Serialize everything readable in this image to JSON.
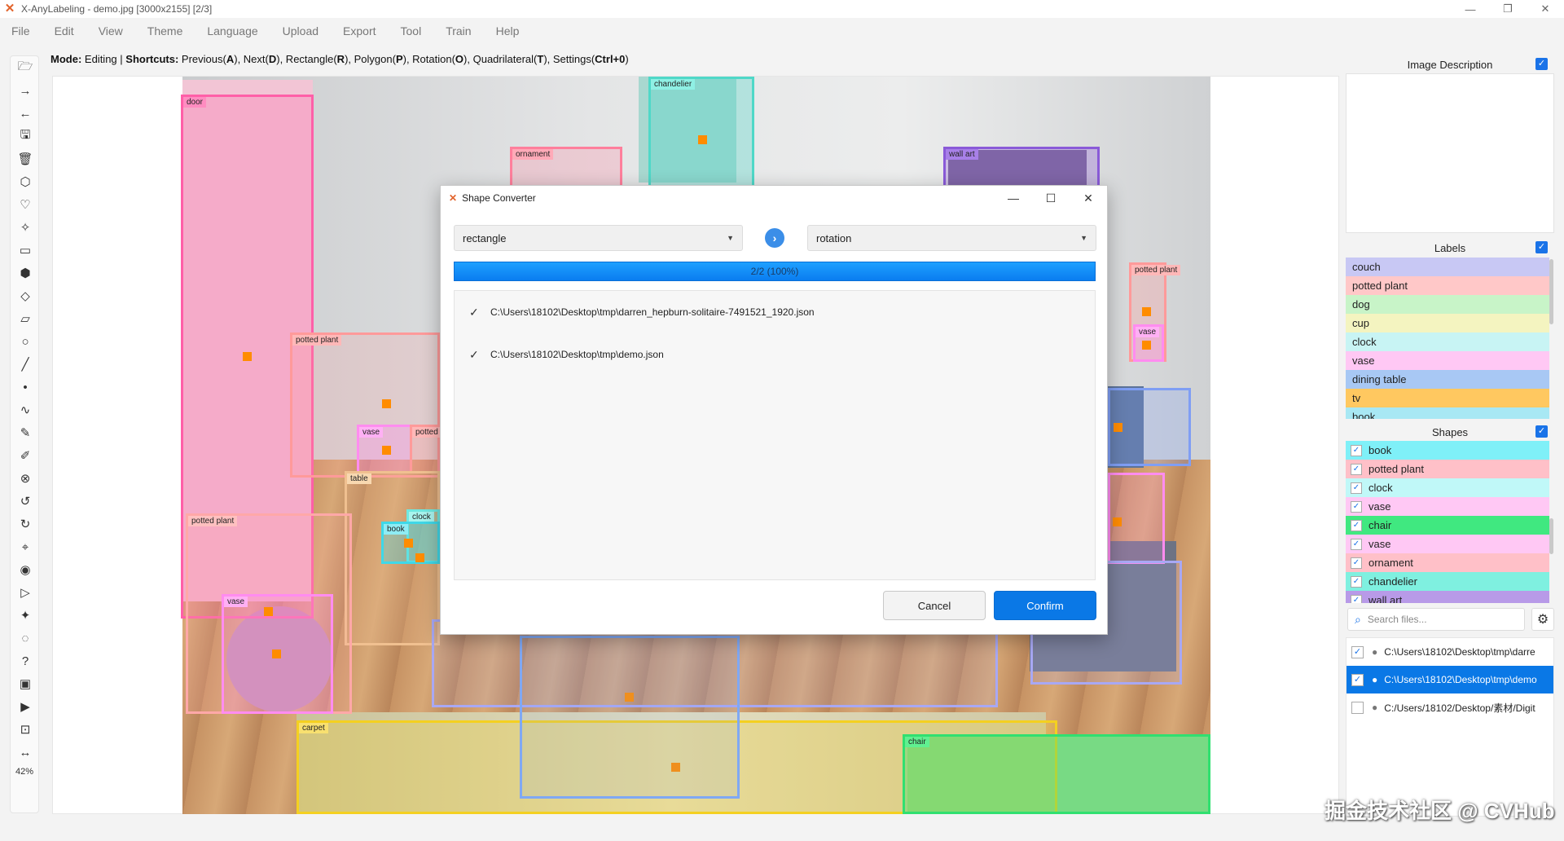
{
  "window": {
    "title": "X-AnyLabeling - demo.jpg [3000x2155] [2/3]"
  },
  "menu": [
    "File",
    "Edit",
    "View",
    "Theme",
    "Language",
    "Upload",
    "Export",
    "Tool",
    "Train",
    "Help"
  ],
  "modeline": {
    "mode_key": "Mode:",
    "mode_val": "Editing",
    "sep": "|",
    "shortcuts_key": "Shortcuts:",
    "prev": "Previous(",
    "prev_k": "A",
    "next": "), Next(",
    "next_k": "D",
    "rect": "), Rectangle(",
    "rect_k": "R",
    "poly": "), Polygon(",
    "poly_k": "P",
    "rot": "), Rotation(",
    "rot_k": "O",
    "quad": "), Quadrilateral(",
    "quad_k": "T",
    "set": "), Settings(",
    "set_k": "Ctrl+0",
    "end": ")"
  },
  "zoom": "42%",
  "annotations": [
    {
      "label": "door",
      "color": "#ff5fa8"
    },
    {
      "label": "chandelier",
      "color": "#4fd8c8"
    },
    {
      "label": "ornament",
      "color": "#ff7f9c"
    },
    {
      "label": "wall art",
      "color": "#8a5ad8"
    },
    {
      "label": "potted plant",
      "color": "#ff9a9a"
    },
    {
      "label": "vase",
      "color": "#ff8cf0"
    },
    {
      "label": "potted",
      "color": "#ff9a9a"
    },
    {
      "label": "table",
      "color": "#f0c090"
    },
    {
      "label": "clock",
      "color": "#6fe8e0"
    },
    {
      "label": "book",
      "color": "#3fd8e8"
    },
    {
      "label": "potted plant",
      "color": "#ffa8a8"
    },
    {
      "label": "vase",
      "color": "#ff8cf0"
    },
    {
      "label": "carpet",
      "color": "#f4d020"
    },
    {
      "label": "chair",
      "color": "#30e070"
    },
    {
      "label": "potted plant",
      "color": "#ff9a9a"
    },
    {
      "label": "vase",
      "color": "#ff8cf0"
    }
  ],
  "dialog": {
    "title": "Shape Converter",
    "from": "rectangle",
    "to": "rotation",
    "progress": "2/2 (100%)",
    "progress_value": 1.0,
    "files": [
      "C:\\Users\\18102\\Desktop\\tmp\\darren_hepburn-solitaire-7491521_1920.json",
      "C:\\Users\\18102\\Desktop\\tmp\\demo.json"
    ],
    "cancel": "Cancel",
    "confirm": "Confirm"
  },
  "panels": {
    "description_title": "Image Description",
    "labels_title": "Labels",
    "shapes_title": "Shapes",
    "search_placeholder": "Search files..."
  },
  "labels": [
    {
      "name": "couch",
      "color": "#c8c8f4"
    },
    {
      "name": "potted plant",
      "color": "#ffc8c8"
    },
    {
      "name": "dog",
      "color": "#c8f4c8"
    },
    {
      "name": "cup",
      "color": "#f4f4c0"
    },
    {
      "name": "clock",
      "color": "#c8f4f4"
    },
    {
      "name": "vase",
      "color": "#ffc8f4"
    },
    {
      "name": "dining table",
      "color": "#a8c8f4"
    },
    {
      "name": "tv",
      "color": "#ffc860"
    },
    {
      "name": "book",
      "color": "#a8e8f4"
    }
  ],
  "shapes": [
    {
      "name": "book",
      "color": "#7ff0f8"
    },
    {
      "name": "potted plant",
      "color": "#ffc0c8"
    },
    {
      "name": "clock",
      "color": "#c0f8f8"
    },
    {
      "name": "vase",
      "color": "#ffc8f4"
    },
    {
      "name": "chair",
      "color": "#40e880"
    },
    {
      "name": "vase",
      "color": "#ffc8f4"
    },
    {
      "name": "ornament",
      "color": "#ffc0c8"
    },
    {
      "name": "chandelier",
      "color": "#7ff0e0"
    },
    {
      "name": "wall art",
      "color": "#b89ae8"
    }
  ],
  "filelist": [
    {
      "path": "C:\\Users\\18102\\Desktop\\tmp\\darre",
      "checked": true
    },
    {
      "path": "C:\\Users\\18102\\Desktop\\tmp\\demo",
      "checked": true
    },
    {
      "path": "C:/Users/18102/Desktop/素材/Digit",
      "checked": false
    }
  ],
  "watermark": "掘金技术社区 @ CVHub"
}
